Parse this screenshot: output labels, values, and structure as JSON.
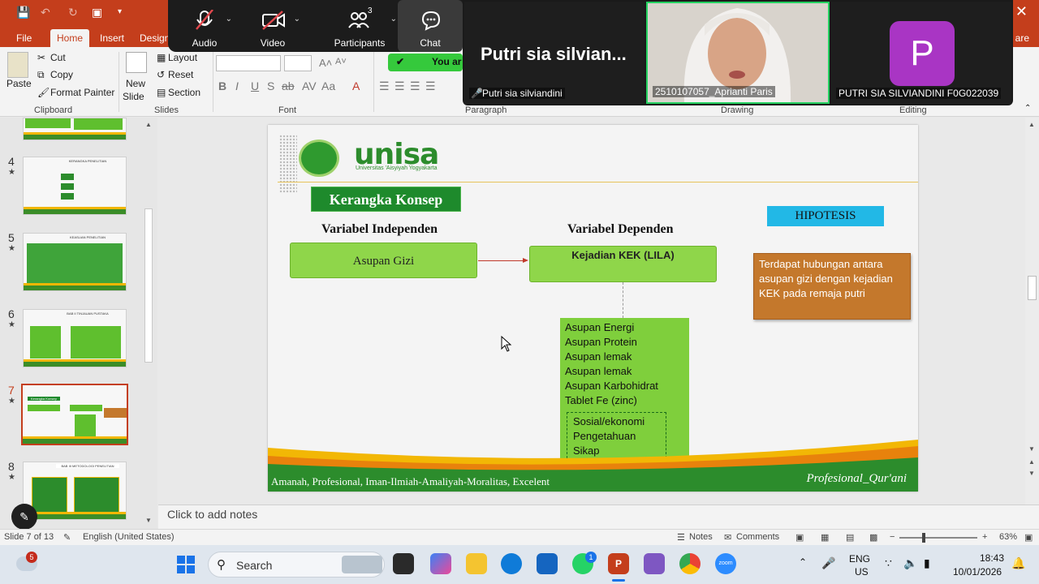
{
  "ribbon": {
    "tabs": [
      "File",
      "Home",
      "Insert",
      "Design"
    ],
    "active_tab": "Home",
    "share_label": "are",
    "clipboard": {
      "paste": "Paste",
      "cut": "Cut",
      "copy": "Copy",
      "format_painter": "Format Painter",
      "group": "Clipboard"
    },
    "slides": {
      "new_slide": "New",
      "new_slide2": "Slide",
      "layout": "Layout",
      "reset": "Reset",
      "section": "Section",
      "group": "Slides"
    },
    "font_group": "Font",
    "paragraph_group": "Paragraph",
    "drawing_group": "Drawing",
    "editing_group": "Editing",
    "banner_text": "You ar"
  },
  "zoom": {
    "audio": "Audio",
    "video": "Video",
    "participants": "Participants",
    "participants_count": "3",
    "chat": "Chat",
    "tiles": [
      {
        "big_name": "Putri sia silvian...",
        "label": "Putri sia silviandini"
      },
      {
        "label": "2510107057_Aprianti Paris"
      },
      {
        "avatar_letter": "P",
        "label": "PUTRI SIA SILVIANDINI F0G022039"
      }
    ]
  },
  "thumbnails": [
    {
      "num": "4",
      "title": "KERANGKA PENELITIAN"
    },
    {
      "num": "5",
      "title": "KEASLIAN PENELITIAN"
    },
    {
      "num": "6",
      "title": "BAB II TINJAUAN PUSTAKA"
    },
    {
      "num": "7",
      "title": "Kerangka Konsep",
      "selected": true
    },
    {
      "num": "8",
      "title": "BAB III METODOLOGI PENELITIAN"
    }
  ],
  "slide": {
    "logo_text": "unisa",
    "logo_sub": "Universitas 'Aisyiyah Yogyakarta",
    "title": "Kerangka Konsep",
    "var_independen": "Variabel Independen",
    "var_dependen": "Variabel Dependen",
    "box_independen": "Asupan Gizi",
    "box_dependen": "Kejadian KEK (LILA)",
    "factors": [
      "Asupan Energi",
      "Asupan Protein",
      "Asupan lemak",
      "Asupan lemak",
      "Asupan Karbohidrat",
      "Tablet Fe (zinc)"
    ],
    "confounders": [
      "Sosial/ekonomi",
      "Pengetahuan",
      "Sikap"
    ],
    "hipotesis_label": "HIPOTESIS",
    "hipotesis_text": "Terdapat hubungan antara asupan gizi dengan kejadian KEK pada remaja putri",
    "footer_left": "Amanah, Profesional, Iman-Ilmiah-Amaliyah-Moralitas, Excelent",
    "footer_right": "Profesional_Qur'ani"
  },
  "notes_placeholder": "Click to add notes",
  "status": {
    "slide_info": "Slide 7 of 13",
    "language": "English (United States)",
    "notes": "Notes",
    "comments": "Comments",
    "zoom_level": "63%"
  },
  "taskbar": {
    "search": "Search",
    "weather_badge": "5",
    "whatsapp_badge": "1",
    "lang1": "ENG",
    "lang2": "US",
    "time": "18:43",
    "date": "10/01/2026"
  }
}
